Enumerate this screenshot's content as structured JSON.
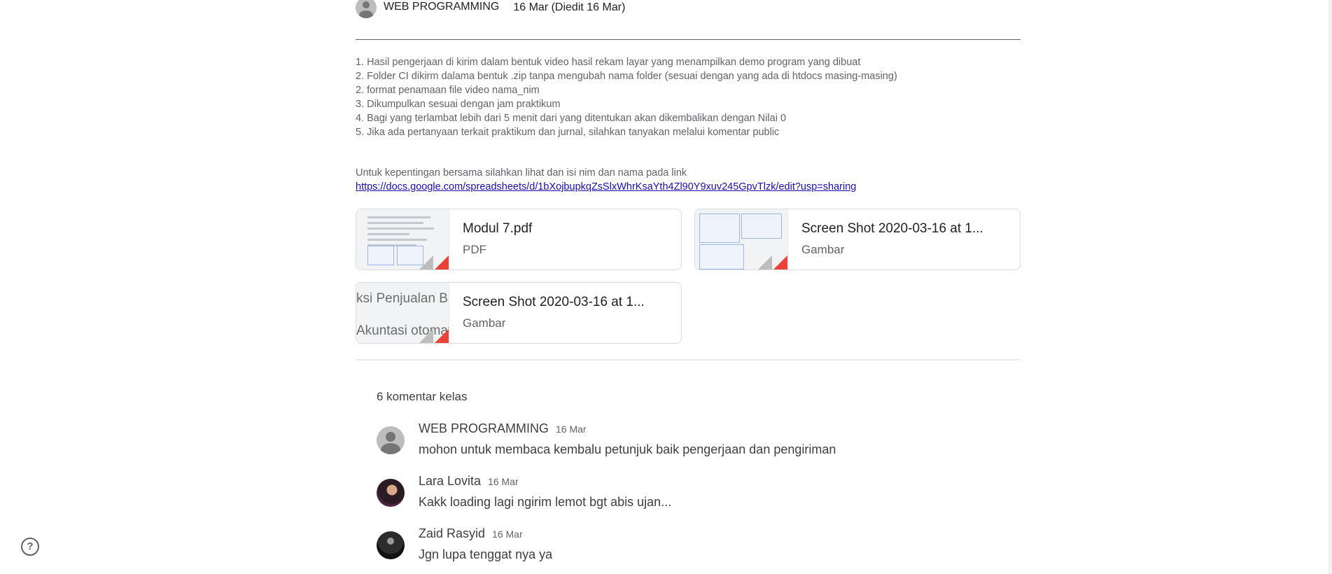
{
  "post": {
    "author": "WEB PROGRAMMING",
    "date": "16 Mar (Diedit 16 Mar)",
    "instructions": [
      "1. Hasil pengerjaan di kirim dalam bentuk video hasil rekam layar yang menampilkan demo program yang dibuat",
      "2. Folder CI dikirm dalama bentuk .zip tanpa mengubah nama folder (sesuai dengan yang ada di htdocs masing-masing)",
      "2. format penamaan file video nama_nim",
      "3. Dikumpulkan sesuai dengan jam praktikum",
      "4. Bagi yang terlambat lebih dari 5 menit dari yang ditentukan akan dikembalikan dengan Nilai 0",
      "5. Jika ada pertanyaan terkait praktikum dan jurnal, silahkan tanyakan melalui komentar public"
    ],
    "note": "Untuk kepentingan bersama silahkan lihat dan isi nim dan nama pada link",
    "link": "https://docs.google.com/spreadsheets/d/1bXojbupkqZsSlxWhrKsaYth4Zl90Y9xuv245GpvTlzk/edit?usp=sharing"
  },
  "attachments": [
    {
      "name": "Modul 7.pdf",
      "type": "PDF"
    },
    {
      "name": "Screen Shot 2020-03-16 at 1...",
      "type": "Gambar"
    },
    {
      "name": "Screen Shot 2020-03-16 at 1...",
      "type": "Gambar",
      "thumb_line1": "ksi Penjualan Be",
      "thumb_line2": "Akuntasi otomat"
    }
  ],
  "comments_count": "6 komentar kelas",
  "comments": [
    {
      "name": "WEB PROGRAMMING",
      "date": "16 Mar",
      "text": "mohon untuk membaca kembalu petunjuk baik pengerjaan dan pengiriman"
    },
    {
      "name": "Lara Lovita",
      "date": "16 Mar",
      "text": "Kakk loading lagi ngirim lemot bgt abis ujan..."
    },
    {
      "name": "Zaid Rasyid",
      "date": "16 Mar",
      "text": "Jgn lupa tenggat nya ya"
    }
  ],
  "help": {
    "icon": "help-icon",
    "glyph": "?"
  }
}
